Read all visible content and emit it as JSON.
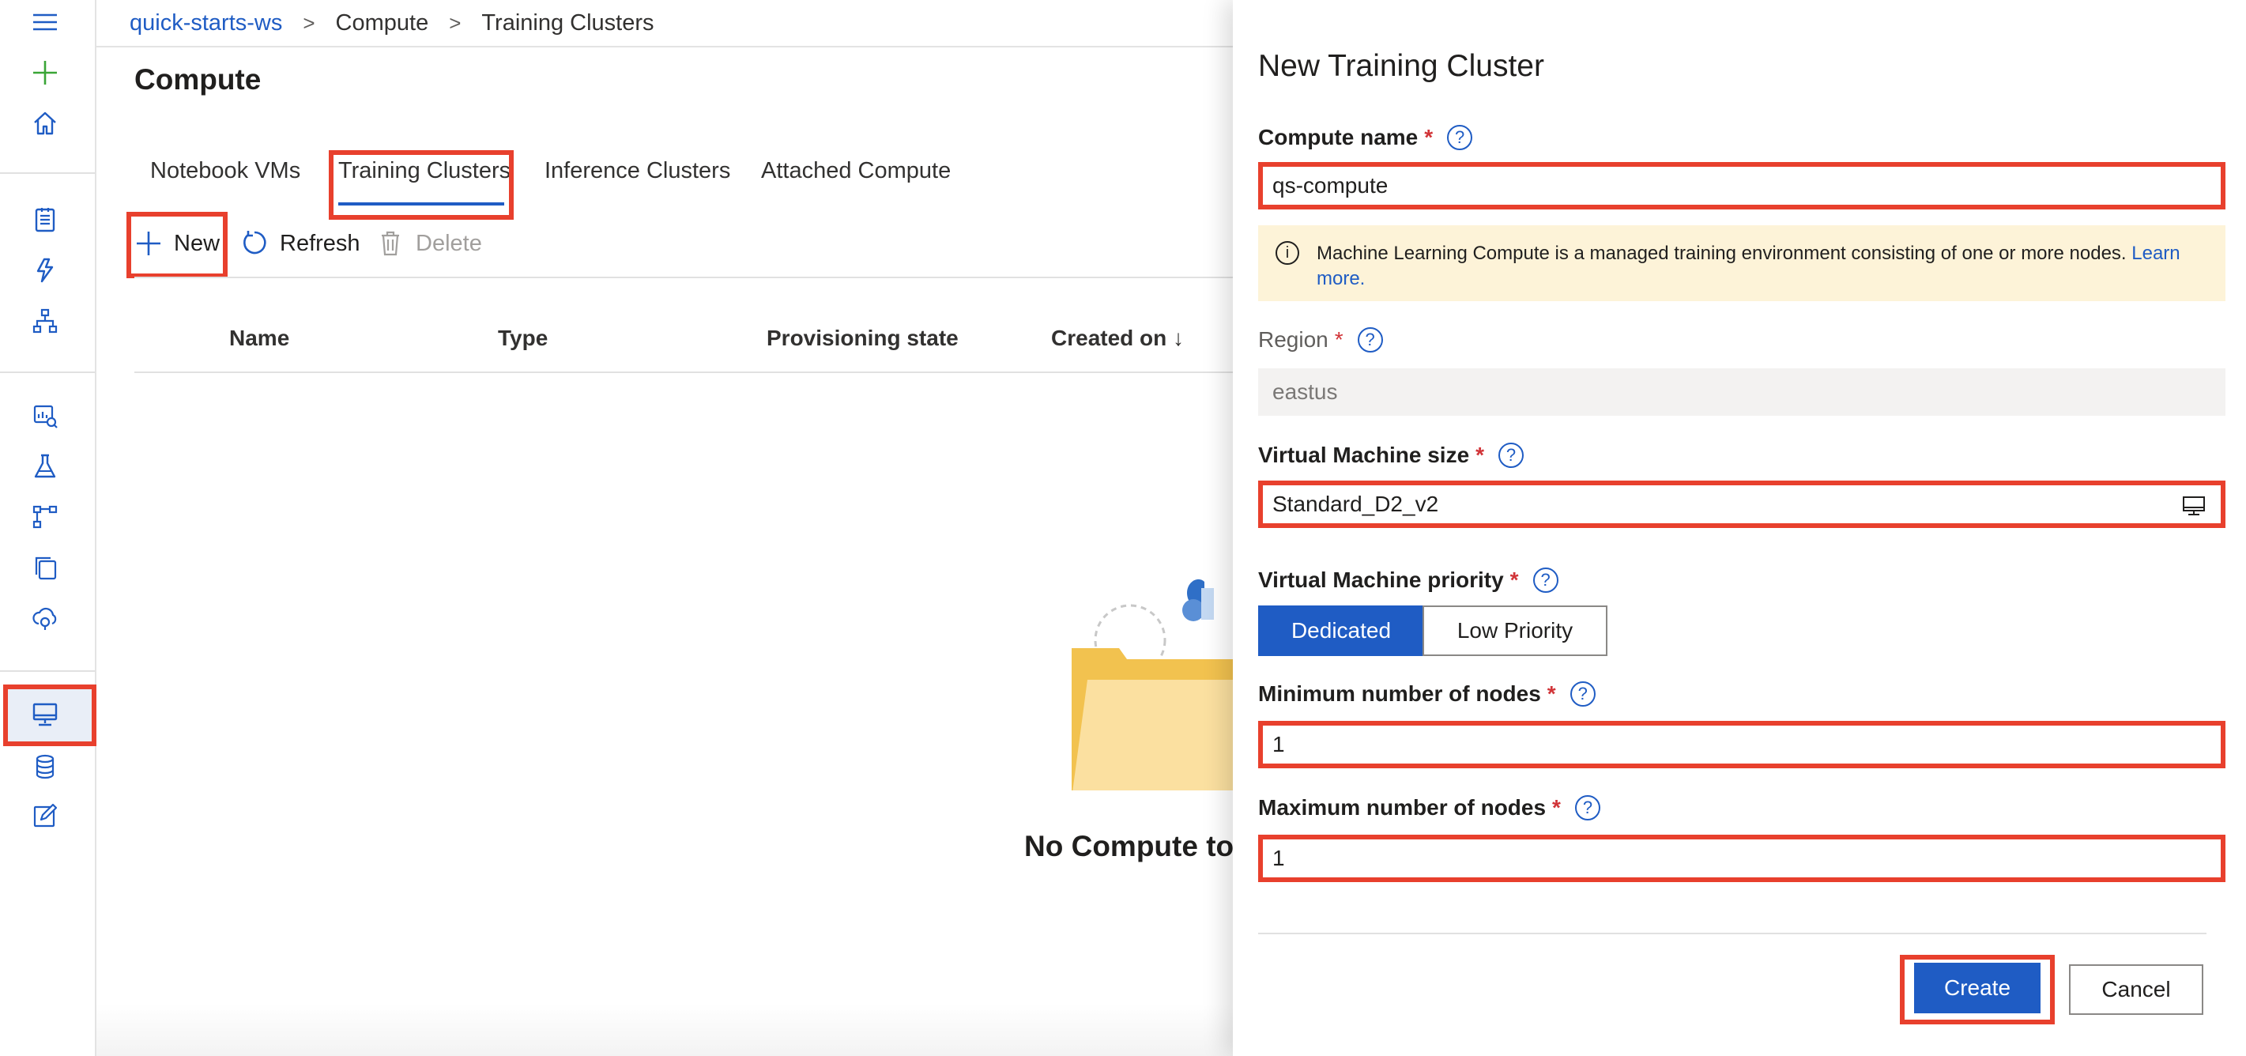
{
  "breadcrumb": {
    "workspace": "quick-starts-ws",
    "section": "Compute",
    "current": "Training Clusters"
  },
  "page": {
    "title": "Compute"
  },
  "tabs": [
    {
      "label": "Notebook VMs"
    },
    {
      "label": "Training Clusters",
      "active": true
    },
    {
      "label": "Inference Clusters"
    },
    {
      "label": "Attached Compute"
    }
  ],
  "toolbar": {
    "new_label": "New",
    "refresh_label": "Refresh",
    "delete_label": "Delete"
  },
  "table": {
    "columns": [
      "Name",
      "Type",
      "Provisioning state",
      "Created on ↓"
    ]
  },
  "empty_state": {
    "message": "No Compute to"
  },
  "rail": {
    "icons": [
      "menu-icon",
      "add-icon",
      "home-icon",
      "notebook-icon",
      "automl-icon",
      "designer-icon",
      "datasets-icon",
      "experiments-icon",
      "pipelines-icon",
      "models-icon",
      "endpoints-icon",
      "compute-icon",
      "datastores-icon",
      "labeling-icon"
    ]
  },
  "panel": {
    "title": "New Training Cluster",
    "compute_name": {
      "label": "Compute name",
      "value": "qs-compute"
    },
    "info": {
      "text": "Machine Learning Compute is a managed training environment consisting of one or more nodes.",
      "link": "Learn more."
    },
    "region": {
      "label": "Region",
      "value": "eastus"
    },
    "vm_size": {
      "label": "Virtual Machine size",
      "value": "Standard_D2_v2"
    },
    "vm_priority": {
      "label": "Virtual Machine priority",
      "options": [
        "Dedicated",
        "Low Priority"
      ],
      "selected": "Dedicated"
    },
    "min_nodes": {
      "label": "Minimum number of nodes",
      "value": "1"
    },
    "max_nodes": {
      "label": "Maximum number of nodes",
      "value": "1"
    },
    "required_mark": "*",
    "help_glyph": "?",
    "info_glyph": "i",
    "create_label": "Create",
    "cancel_label": "Cancel"
  },
  "colors": {
    "accent": "#1f5cc4",
    "highlight": "#e8402d",
    "info_bg": "#fdf3d8"
  }
}
